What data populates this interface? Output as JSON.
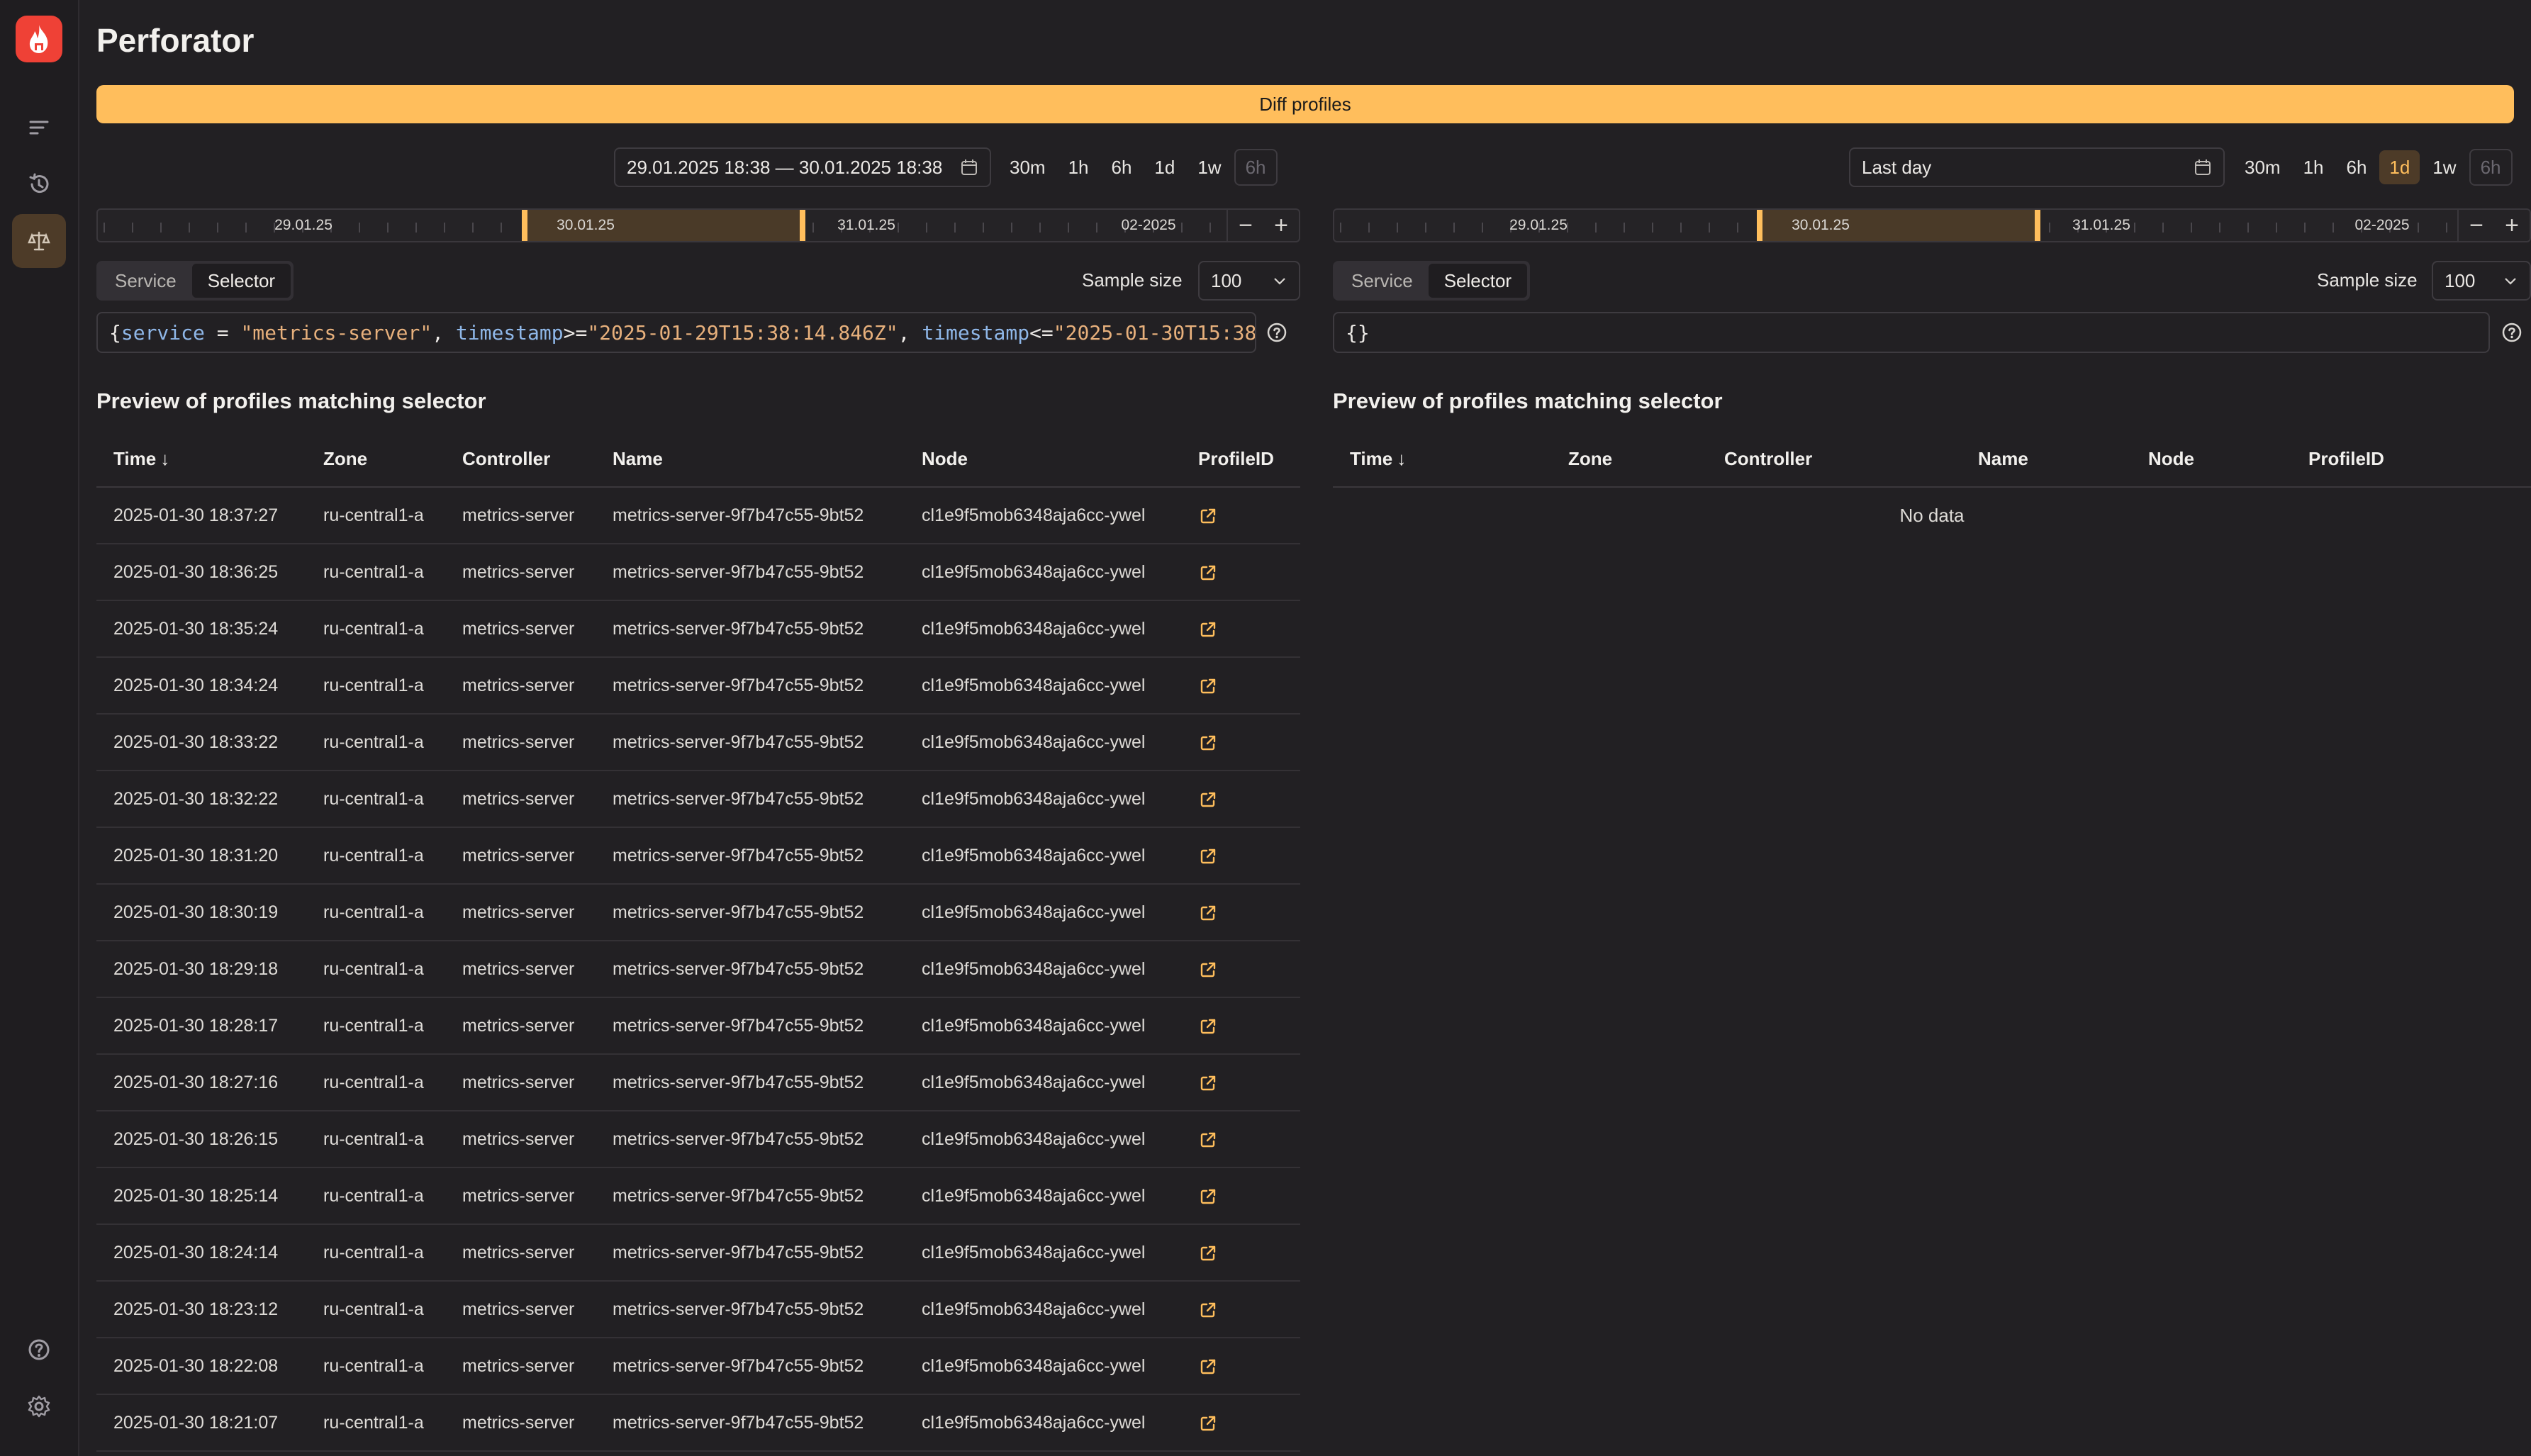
{
  "app": {
    "title": "Perforator"
  },
  "diff_button": {
    "label": "Diff profiles"
  },
  "colors": {
    "accent": "#ffbe5c",
    "brand": "#ef4136",
    "background": "#222023"
  },
  "icons": {
    "sidebar": [
      "flame-logo-icon",
      "list-icon",
      "history-icon",
      "scales-icon",
      "help-icon",
      "gear-icon"
    ],
    "open_profile": "external-link-icon"
  },
  "left": {
    "date_range": "29.01.2025 18:38 — 30.01.2025 18:38",
    "presets": [
      {
        "label": "30m",
        "state": "normal"
      },
      {
        "label": "1h",
        "state": "normal"
      },
      {
        "label": "6h",
        "state": "normal"
      },
      {
        "label": "1d",
        "state": "normal"
      },
      {
        "label": "1w",
        "state": "normal"
      },
      {
        "label": "6h",
        "state": "disabled"
      }
    ],
    "timeline_labels": [
      "29.01.25",
      "30.01.25",
      "31.01.25",
      "02-2025"
    ],
    "mode_tabs": [
      "Service",
      "Selector"
    ],
    "active_mode": "Selector",
    "sample_size_label": "Sample size",
    "sample_size_value": "100",
    "selector": {
      "open": "{",
      "k1": "service",
      "op1": " = ",
      "v1": "\"metrics-server\"",
      "sep1": ", ",
      "k2": "timestamp",
      "op2": ">=",
      "v2": "\"2025-01-29T15:38:14.846Z\"",
      "sep2": ", ",
      "k3": "timestamp",
      "op3": "<=",
      "v3": "\"2025-01-30T15:38"
    },
    "preview_title": "Preview of profiles matching selector",
    "columns": [
      "Time",
      "Zone",
      "Controller",
      "Name",
      "Node",
      "ProfileID"
    ],
    "rows": [
      {
        "time": "2025-01-30 18:37:27",
        "zone": "ru-central1-a",
        "controller": "metrics-server",
        "name": "metrics-server-9f7b47c55-9bt52",
        "node": "cl1e9f5mob6348aja6cc-ywel"
      },
      {
        "time": "2025-01-30 18:36:25",
        "zone": "ru-central1-a",
        "controller": "metrics-server",
        "name": "metrics-server-9f7b47c55-9bt52",
        "node": "cl1e9f5mob6348aja6cc-ywel"
      },
      {
        "time": "2025-01-30 18:35:24",
        "zone": "ru-central1-a",
        "controller": "metrics-server",
        "name": "metrics-server-9f7b47c55-9bt52",
        "node": "cl1e9f5mob6348aja6cc-ywel"
      },
      {
        "time": "2025-01-30 18:34:24",
        "zone": "ru-central1-a",
        "controller": "metrics-server",
        "name": "metrics-server-9f7b47c55-9bt52",
        "node": "cl1e9f5mob6348aja6cc-ywel"
      },
      {
        "time": "2025-01-30 18:33:22",
        "zone": "ru-central1-a",
        "controller": "metrics-server",
        "name": "metrics-server-9f7b47c55-9bt52",
        "node": "cl1e9f5mob6348aja6cc-ywel"
      },
      {
        "time": "2025-01-30 18:32:22",
        "zone": "ru-central1-a",
        "controller": "metrics-server",
        "name": "metrics-server-9f7b47c55-9bt52",
        "node": "cl1e9f5mob6348aja6cc-ywel"
      },
      {
        "time": "2025-01-30 18:31:20",
        "zone": "ru-central1-a",
        "controller": "metrics-server",
        "name": "metrics-server-9f7b47c55-9bt52",
        "node": "cl1e9f5mob6348aja6cc-ywel"
      },
      {
        "time": "2025-01-30 18:30:19",
        "zone": "ru-central1-a",
        "controller": "metrics-server",
        "name": "metrics-server-9f7b47c55-9bt52",
        "node": "cl1e9f5mob6348aja6cc-ywel"
      },
      {
        "time": "2025-01-30 18:29:18",
        "zone": "ru-central1-a",
        "controller": "metrics-server",
        "name": "metrics-server-9f7b47c55-9bt52",
        "node": "cl1e9f5mob6348aja6cc-ywel"
      },
      {
        "time": "2025-01-30 18:28:17",
        "zone": "ru-central1-a",
        "controller": "metrics-server",
        "name": "metrics-server-9f7b47c55-9bt52",
        "node": "cl1e9f5mob6348aja6cc-ywel"
      },
      {
        "time": "2025-01-30 18:27:16",
        "zone": "ru-central1-a",
        "controller": "metrics-server",
        "name": "metrics-server-9f7b47c55-9bt52",
        "node": "cl1e9f5mob6348aja6cc-ywel"
      },
      {
        "time": "2025-01-30 18:26:15",
        "zone": "ru-central1-a",
        "controller": "metrics-server",
        "name": "metrics-server-9f7b47c55-9bt52",
        "node": "cl1e9f5mob6348aja6cc-ywel"
      },
      {
        "time": "2025-01-30 18:25:14",
        "zone": "ru-central1-a",
        "controller": "metrics-server",
        "name": "metrics-server-9f7b47c55-9bt52",
        "node": "cl1e9f5mob6348aja6cc-ywel"
      },
      {
        "time": "2025-01-30 18:24:14",
        "zone": "ru-central1-a",
        "controller": "metrics-server",
        "name": "metrics-server-9f7b47c55-9bt52",
        "node": "cl1e9f5mob6348aja6cc-ywel"
      },
      {
        "time": "2025-01-30 18:23:12",
        "zone": "ru-central1-a",
        "controller": "metrics-server",
        "name": "metrics-server-9f7b47c55-9bt52",
        "node": "cl1e9f5mob6348aja6cc-ywel"
      },
      {
        "time": "2025-01-30 18:22:08",
        "zone": "ru-central1-a",
        "controller": "metrics-server",
        "name": "metrics-server-9f7b47c55-9bt52",
        "node": "cl1e9f5mob6348aja6cc-ywel"
      },
      {
        "time": "2025-01-30 18:21:07",
        "zone": "ru-central1-a",
        "controller": "metrics-server",
        "name": "metrics-server-9f7b47c55-9bt52",
        "node": "cl1e9f5mob6348aja6cc-ywel"
      }
    ]
  },
  "right": {
    "date_range": "Last day",
    "presets": [
      {
        "label": "30m",
        "state": "normal"
      },
      {
        "label": "1h",
        "state": "normal"
      },
      {
        "label": "6h",
        "state": "normal"
      },
      {
        "label": "1d",
        "state": "active"
      },
      {
        "label": "1w",
        "state": "normal"
      },
      {
        "label": "6h",
        "state": "disabled"
      }
    ],
    "timeline_labels": [
      "29.01.25",
      "30.01.25",
      "31.01.25",
      "02-2025"
    ],
    "mode_tabs": [
      "Service",
      "Selector"
    ],
    "active_mode": "Selector",
    "sample_size_label": "Sample size",
    "sample_size_value": "100",
    "selector": "{}",
    "preview_title": "Preview of profiles matching selector",
    "columns": [
      "Time",
      "Zone",
      "Controller",
      "Name",
      "Node",
      "ProfileID"
    ],
    "empty_text": "No data"
  }
}
